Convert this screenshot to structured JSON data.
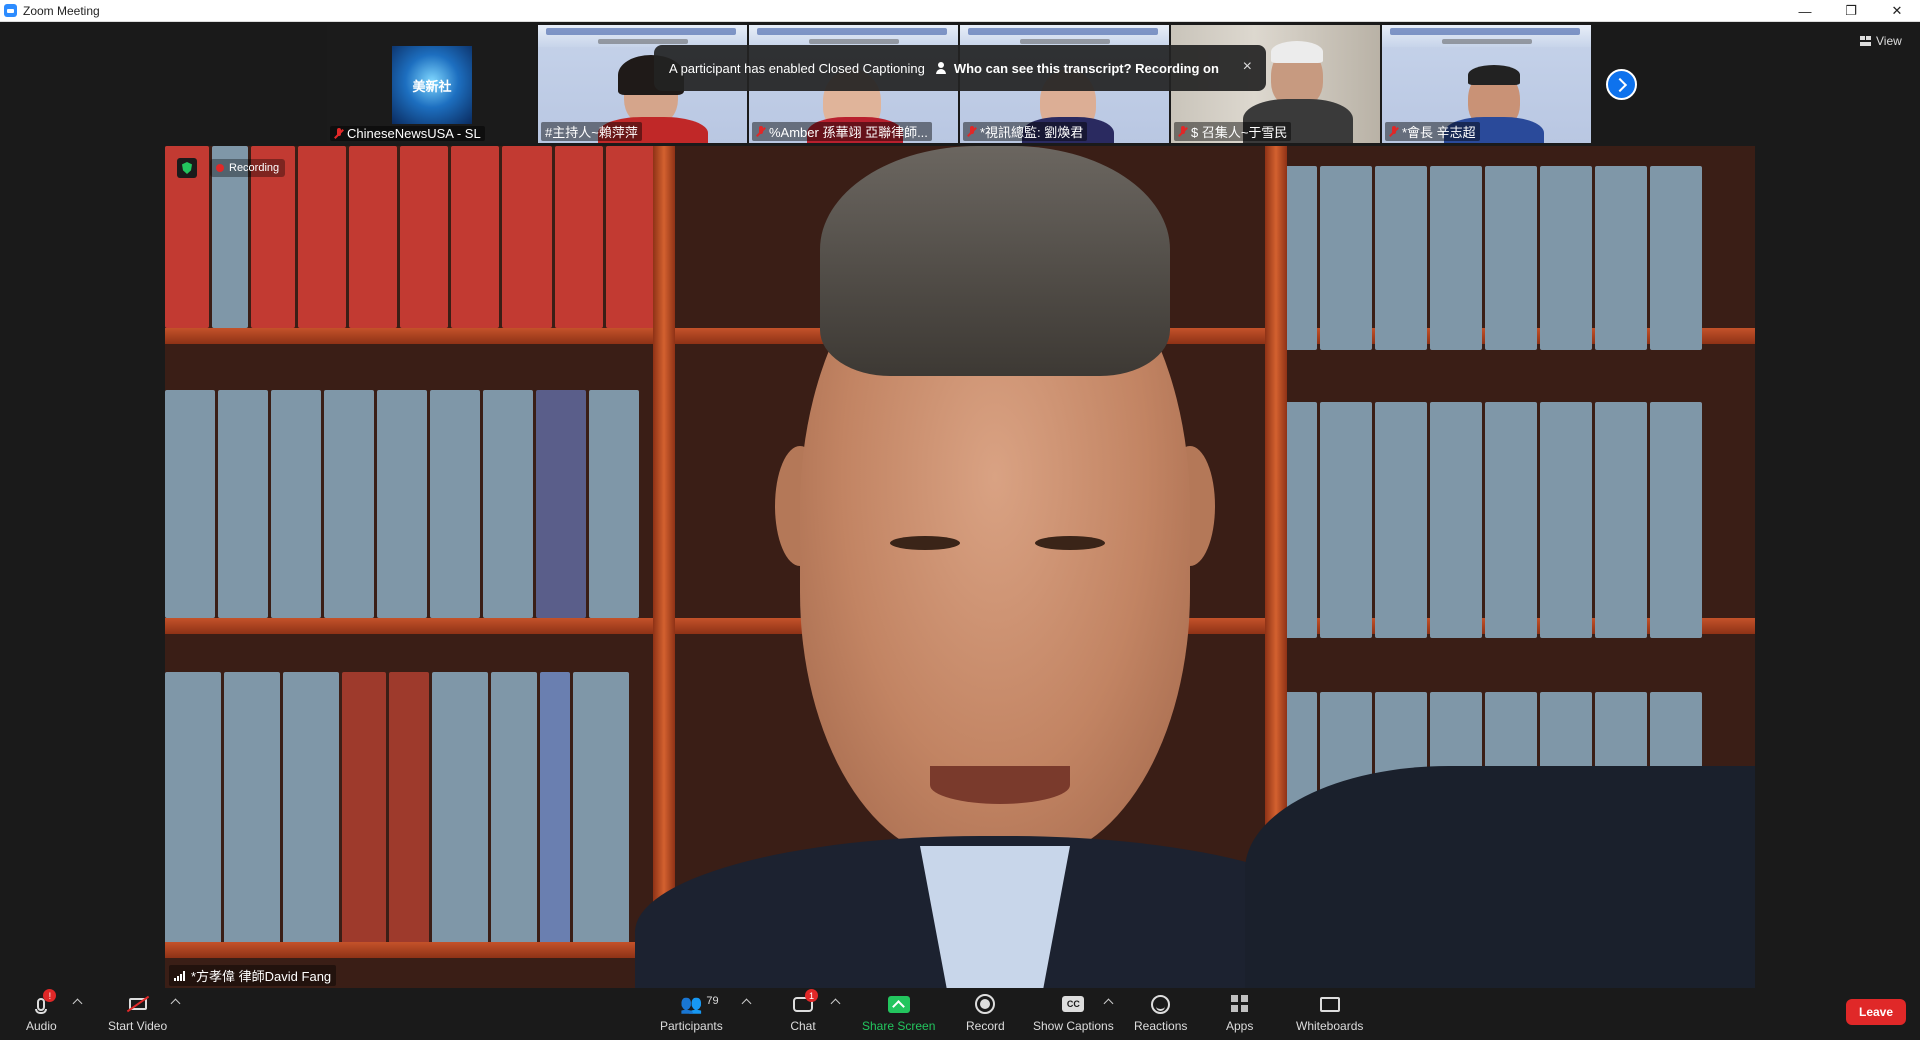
{
  "window": {
    "title": "Zoom Meeting",
    "controls": [
      "—",
      "❐",
      "✕"
    ]
  },
  "thumbnails": [
    {
      "name": "ChineseNewsUSA - SL",
      "logo_text": "美新社"
    },
    {
      "name": "#主持人~賴萍萍"
    },
    {
      "name": "%Amber 孫華翊 亞聯律師..."
    },
    {
      "name": "*視訊總監: 劉煥君"
    },
    {
      "name": "$ 召集人~于雪民"
    },
    {
      "name": "*會長 辛志超"
    }
  ],
  "caption_notice": {
    "message": "A participant has enabled Closed Captioning",
    "link": "Who can see this transcript? Recording on",
    "close": "×"
  },
  "view_button": {
    "label": "View"
  },
  "main_video": {
    "recording_label": "Recording",
    "speaker_name": "*方孝偉 律師David Fang"
  },
  "toolbar": {
    "audio": {
      "label": "Audio",
      "badge": "!"
    },
    "video": {
      "label": "Start Video"
    },
    "participants": {
      "label": "Participants",
      "count": "79"
    },
    "chat": {
      "label": "Chat",
      "badge": "1"
    },
    "share": {
      "label": "Share Screen"
    },
    "record": {
      "label": "Record"
    },
    "captions": {
      "label": "Show Captions",
      "icon_text": "CC"
    },
    "reactions": {
      "label": "Reactions"
    },
    "apps": {
      "label": "Apps"
    },
    "whiteboards": {
      "label": "Whiteboards"
    },
    "leave": {
      "label": "Leave"
    }
  },
  "colors": {
    "accent_blue": "#0e72ed",
    "share_green": "#23c55e",
    "leave_red": "#e02828",
    "background": "#1a1a1a"
  }
}
